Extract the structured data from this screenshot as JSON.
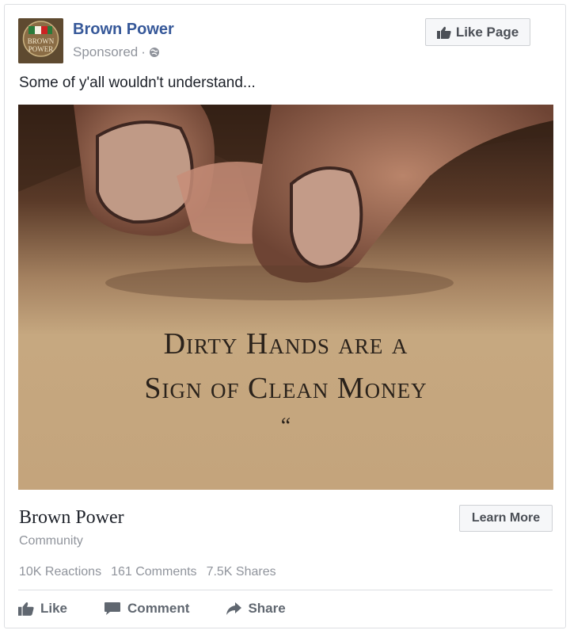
{
  "post": {
    "page_name": "Brown Power",
    "sponsored": "Sponsored",
    "separator": "·",
    "text": "Some of y'all wouldn't understand...",
    "avatar_text": [
      "BROWN",
      "POWER"
    ]
  },
  "header": {
    "like_page_label": "Like Page"
  },
  "image": {
    "quote_line1": "Dirty Hands are a",
    "quote_line2": "Sign of Clean Money",
    "quote_mark": "“"
  },
  "link": {
    "title": "Brown Power",
    "subtitle": "Community",
    "cta_label": "Learn More"
  },
  "stats": {
    "reactions": "10K Reactions",
    "comments": "161 Comments",
    "shares": "7.5K Shares"
  },
  "actions": {
    "like": "Like",
    "comment": "Comment",
    "share": "Share"
  },
  "colors": {
    "page_link": "#365899",
    "muted": "#90949c",
    "image_bg": "#c5a77f"
  },
  "icons": {
    "like_page": "thumbs-up-icon",
    "sponsored": "globe-icon",
    "like": "thumbs-up-icon",
    "comment": "speech-bubble-icon",
    "share": "share-arrow-icon"
  }
}
